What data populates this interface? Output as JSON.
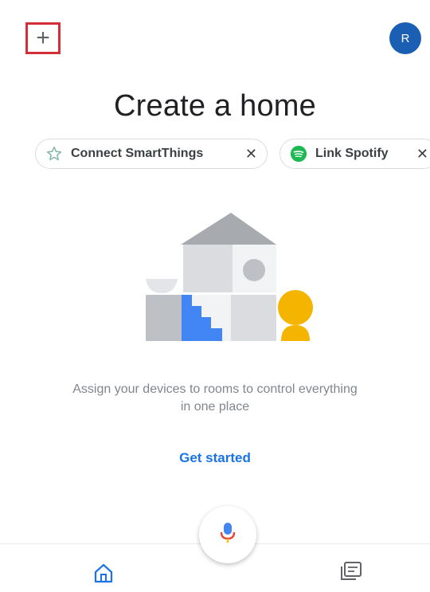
{
  "header": {
    "add_icon": "plus-icon",
    "avatar_initial": "R"
  },
  "title": "Create a home",
  "chips": [
    {
      "label": "Connect SmartThings",
      "icon": "smartthings-star-icon",
      "close": "✕"
    },
    {
      "label": "Link Spotify",
      "icon": "spotify-icon",
      "close": "✕"
    }
  ],
  "illustration": {
    "icon": "home-illustration"
  },
  "description": "Assign your devices to rooms to control everything in one place",
  "get_started": "Get started",
  "nav": {
    "mic_icon": "microphone-icon",
    "home_icon": "home-icon",
    "feed_icon": "feed-icon"
  },
  "colors": {
    "accent": "#1a73e8",
    "avatar": "#1a5fb4",
    "highlight_border": "#d32f3b",
    "spotify": "#1db954"
  }
}
